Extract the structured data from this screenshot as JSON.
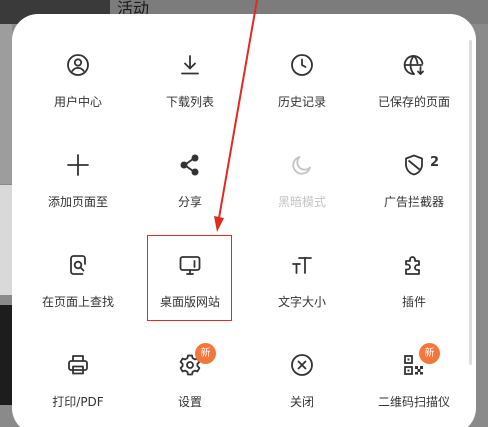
{
  "background": {
    "title": "活动"
  },
  "menu": {
    "items": [
      {
        "label": "用户中心",
        "icon": "user-icon",
        "disabled": false
      },
      {
        "label": "下载列表",
        "icon": "download-icon",
        "disabled": false
      },
      {
        "label": "历史记录",
        "icon": "clock-icon",
        "disabled": false
      },
      {
        "label": "已保存的页面",
        "icon": "globe-download-icon",
        "disabled": false
      },
      {
        "label": "添加页面至",
        "icon": "plus-icon",
        "disabled": false
      },
      {
        "label": "分享",
        "icon": "share-icon",
        "disabled": false
      },
      {
        "label": "黑暗模式",
        "icon": "moon-icon",
        "disabled": true
      },
      {
        "label": "广告拦截器",
        "icon": "shield-icon",
        "disabled": false,
        "count": "2"
      },
      {
        "label": "在页面上查找",
        "icon": "find-in-page-icon",
        "disabled": false
      },
      {
        "label": "桌面版网站",
        "icon": "desktop-icon",
        "disabled": false,
        "highlighted": true
      },
      {
        "label": "文字大小",
        "icon": "text-size-icon",
        "disabled": false
      },
      {
        "label": "插件",
        "icon": "puzzle-icon",
        "disabled": false
      },
      {
        "label": "打印/PDF",
        "icon": "printer-icon",
        "disabled": false
      },
      {
        "label": "设置",
        "icon": "gear-icon",
        "disabled": false,
        "badge": "新"
      },
      {
        "label": "关闭",
        "icon": "close-circle-icon",
        "disabled": false
      },
      {
        "label": "二维码扫描仪",
        "icon": "qr-code-icon",
        "disabled": false,
        "badge": "新"
      }
    ]
  },
  "colors": {
    "annotation": "#e02a22",
    "badge": "#f5753b",
    "icon": "#333333",
    "disabled": "#c4c4c4"
  }
}
